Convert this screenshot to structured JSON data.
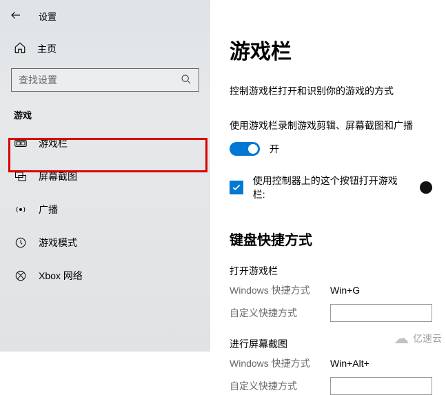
{
  "header": {
    "title": "设置"
  },
  "sidebar": {
    "home_label": "主页",
    "search_placeholder": "查找设置",
    "section_label": "游戏",
    "items": [
      {
        "label": "游戏栏",
        "icon": "gamebar-icon"
      },
      {
        "label": "屏幕截图",
        "icon": "capture-icon"
      },
      {
        "label": "广播",
        "icon": "broadcast-icon"
      },
      {
        "label": "游戏模式",
        "icon": "gamemode-icon"
      },
      {
        "label": "Xbox 网络",
        "icon": "xbox-icon"
      }
    ]
  },
  "main": {
    "title": "游戏栏",
    "description": "控制游戏栏打开和识别你的游戏的方式",
    "record_label": "使用游戏栏录制游戏剪辑、屏幕截图和广播",
    "toggle_state": "开",
    "controller_label": "使用控制器上的这个按钮打开游戏栏:",
    "shortcuts_heading": "键盘快捷方式",
    "groups": [
      {
        "title": "打开游戏栏",
        "win_label": "Windows 快捷方式",
        "win_value": "Win+G",
        "custom_label": "自定义快捷方式",
        "custom_value": ""
      },
      {
        "title": "进行屏幕截图",
        "win_label": "Windows 快捷方式",
        "win_value": "Win+Alt+",
        "custom_label": "自定义快捷方式",
        "custom_value": ""
      }
    ]
  },
  "watermark": "亿速云"
}
